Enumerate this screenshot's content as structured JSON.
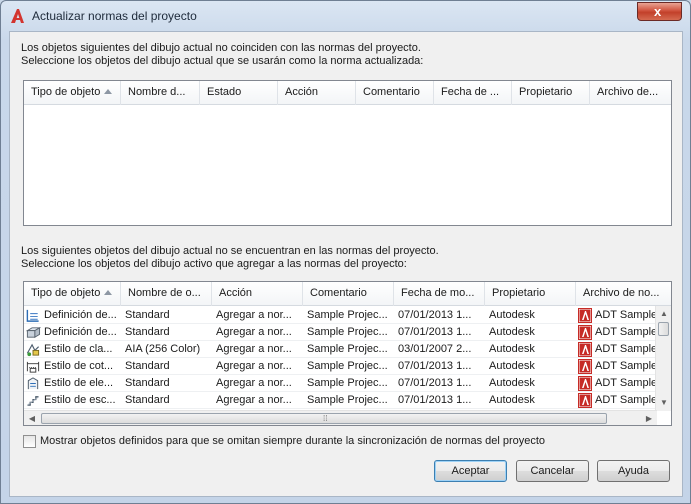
{
  "window": {
    "title": "Actualizar normas del proyecto",
    "close_glyph": "x"
  },
  "section1": {
    "line1": "Los objetos siguientes del dibujo actual no coinciden con las normas del proyecto.",
    "line2": "Seleccione los objetos del dibujo actual que se usarán como la norma actualizada:",
    "columns": [
      "Tipo de objeto",
      "Nombre d...",
      "Estado",
      "Acción",
      "Comentario",
      "Fecha de ...",
      "Propietario",
      "Archivo de..."
    ]
  },
  "section2": {
    "line1": "Los siguientes objetos del dibujo actual no se encuentran en las normas del proyecto.",
    "line2": "Seleccione los objetos del dibujo activo que agregar a las normas del proyecto:",
    "columns": [
      "Tipo de objeto",
      "Nombre de o...",
      "Acción",
      "Comentario",
      "Fecha de mo...",
      "Propietario",
      "Archivo de no..."
    ],
    "rows": [
      {
        "icon": "wall-style-icon",
        "type": "Definición de...",
        "name": "Standard",
        "action": "Agregar a nor...",
        "comment": "Sample Projec...",
        "date": "07/01/2013 1...",
        "owner": "Autodesk",
        "file": "ADT Sample"
      },
      {
        "icon": "slab-style-icon",
        "type": "Definición de...",
        "name": "Standard",
        "action": "Agregar a nor...",
        "comment": "Sample Projec...",
        "date": "07/01/2013 1...",
        "owner": "Autodesk",
        "file": "ADT Sample"
      },
      {
        "icon": "classification-style-icon",
        "type": "Estilo de cla...",
        "name": "AIA (256 Color)",
        "action": "Agregar a nor...",
        "comment": "Sample Projec...",
        "date": "03/01/2007 2...",
        "owner": "Autodesk",
        "file": "ADT Sample"
      },
      {
        "icon": "dimension-style-icon",
        "type": "Estilo de cot...",
        "name": "Standard",
        "action": "Agregar a nor...",
        "comment": "Sample Projec...",
        "date": "07/01/2013 1...",
        "owner": "Autodesk",
        "file": "ADT Sample"
      },
      {
        "icon": "elevation-style-icon",
        "type": "Estilo de ele...",
        "name": "Standard",
        "action": "Agregar a nor...",
        "comment": "Sample Projec...",
        "date": "07/01/2013 1...",
        "owner": "Autodesk",
        "file": "ADT Sample"
      },
      {
        "icon": "stair-style-icon",
        "type": "Estilo de esc...",
        "name": "Standard",
        "action": "Agregar a nor...",
        "comment": "Sample Projec...",
        "date": "07/01/2013 1...",
        "owner": "Autodesk",
        "file": "ADT Sample"
      }
    ]
  },
  "checkbox": {
    "label": "Mostrar objetos definidos para que se omitan siempre durante la sincronización de normas del proyecto",
    "checked": false
  },
  "buttons": {
    "accept": "Aceptar",
    "cancel": "Cancelar",
    "help": "Ayuda"
  },
  "colors": {
    "pdf_red": "#c62b26",
    "accent": "#3c7fb1"
  }
}
